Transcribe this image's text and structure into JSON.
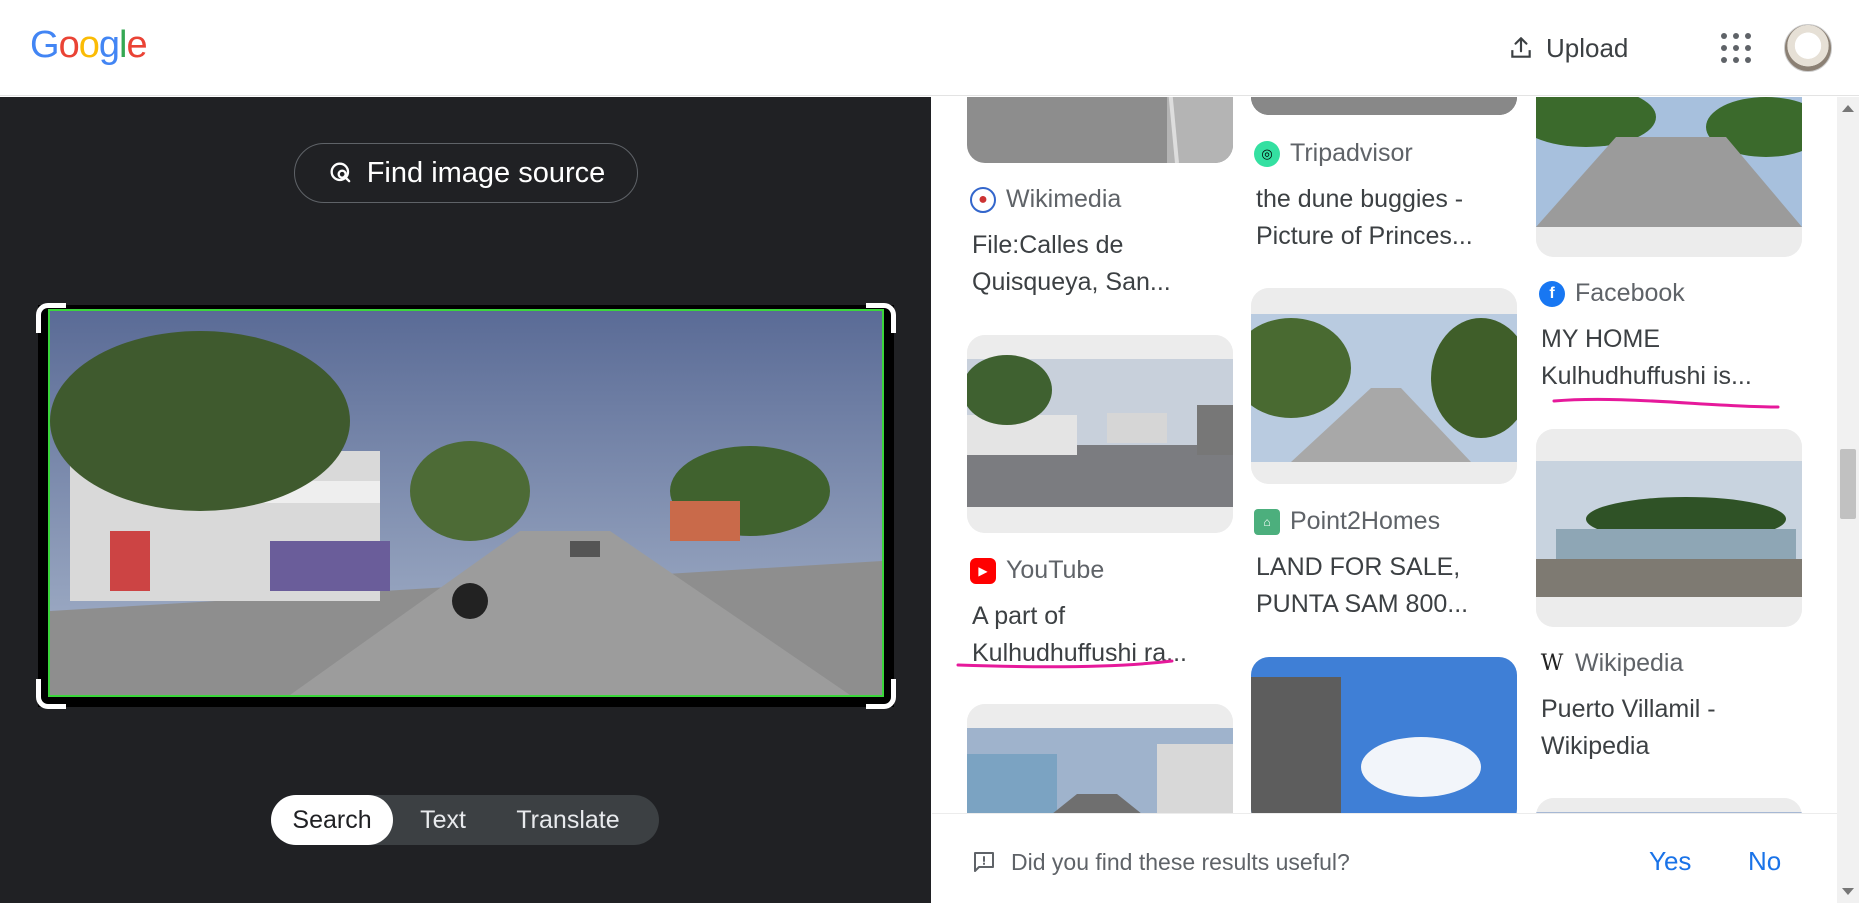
{
  "header": {
    "logo_letters": [
      "G",
      "o",
      "o",
      "g",
      "l",
      "e"
    ],
    "logo_colors": [
      "#4285F4",
      "#EA4335",
      "#FBBC05",
      "#4285F4",
      "#34A853",
      "#EA4335"
    ],
    "upload_label": "Upload"
  },
  "left_panel": {
    "find_source_label": "Find image source",
    "mode_tabs": [
      "Search",
      "Text",
      "Translate"
    ],
    "active_tab": "Search"
  },
  "results": [
    {
      "source": "Wikimedia",
      "title_lines": [
        "File:Calles de",
        "Quisqueya, San..."
      ],
      "icon": "wikimedia-icon"
    },
    {
      "source": "YouTube",
      "title_lines": [
        "A part of",
        "Kulhudhuffushi ra..."
      ],
      "icon": "youtube-icon"
    },
    {
      "source": "Tripadvisor",
      "title_lines": [
        "the dune buggies -",
        "Picture of Princes..."
      ],
      "icon": "tripadvisor-icon"
    },
    {
      "source": "Point2Homes",
      "title_lines": [
        "LAND FOR SALE,",
        "PUNTA SAM 800..."
      ],
      "icon": "point2homes-icon"
    },
    {
      "source": "Facebook",
      "title_lines": [
        "MY HOME",
        "Kulhudhuffushi is..."
      ],
      "icon": "facebook-icon"
    },
    {
      "source": "Wikipedia",
      "title_lines": [
        "Puerto Villamil -",
        "Wikipedia"
      ],
      "icon": "wikipedia-icon"
    }
  ],
  "feedback": {
    "question": "Did you find these results useful?",
    "yes_label": "Yes",
    "no_label": "No"
  },
  "colors": {
    "crop_border": "#3bd63b",
    "annotation_pink": "#e6199b",
    "link_blue": "#1a73e8",
    "youtube_red": "#ff0000",
    "facebook_blue": "#1877f2",
    "tripadvisor_green": "#34e0a1",
    "point2_green": "#4caf7d"
  }
}
